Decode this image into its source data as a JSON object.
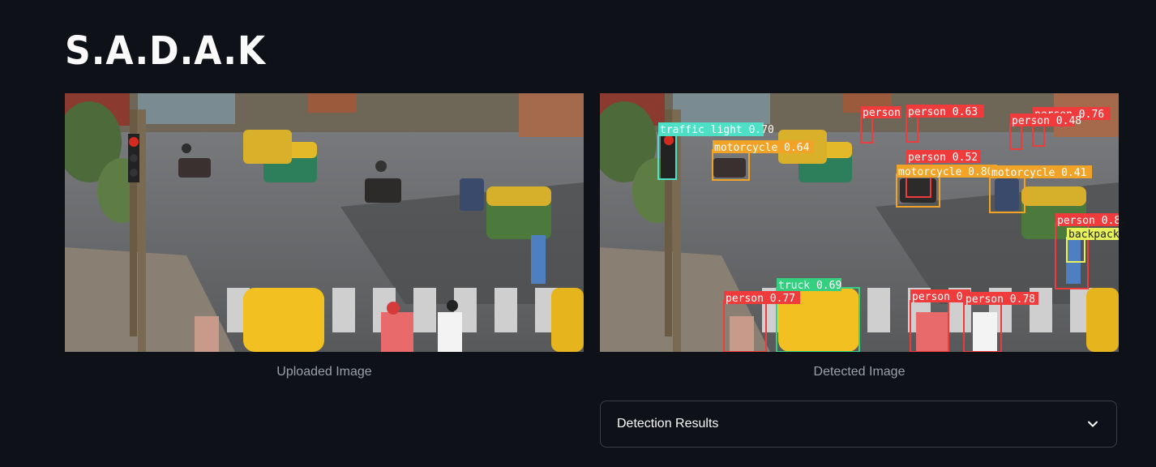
{
  "app": {
    "title": "S.A.D.A.K"
  },
  "uploaded": {
    "caption": "Uploaded Image"
  },
  "detected": {
    "caption": "Detected Image",
    "detections": [
      {
        "label": "traffic light 0.70",
        "color": "#4de0c6"
      },
      {
        "label": "motorcycle 0.64",
        "color": "#f0a326"
      },
      {
        "label": "person 0.63",
        "color": "#ef3b3b"
      },
      {
        "label": "person 0.76",
        "color": "#ef3b3b"
      },
      {
        "label": "person 0.48",
        "color": "#ef3b3b"
      },
      {
        "label": "person 0.52",
        "color": "#ef3b3b"
      },
      {
        "label": "motorcycle 0.80",
        "color": "#f0a326"
      },
      {
        "label": "motorcycle 0.41",
        "color": "#f0a326"
      },
      {
        "label": "person 0.8",
        "color": "#ef3b3b"
      },
      {
        "label": "backpack",
        "color": "#e7f25b"
      },
      {
        "label": "truck 0.69",
        "color": "#35d07f"
      },
      {
        "label": "person 0.77",
        "color": "#ef3b3b"
      },
      {
        "label": "person 0.",
        "color": "#ef3b3b"
      },
      {
        "label": "person 0.78",
        "color": "#ef3b3b"
      }
    ]
  },
  "results": {
    "label": "Detection Results",
    "icon": "chevron-down-icon"
  }
}
